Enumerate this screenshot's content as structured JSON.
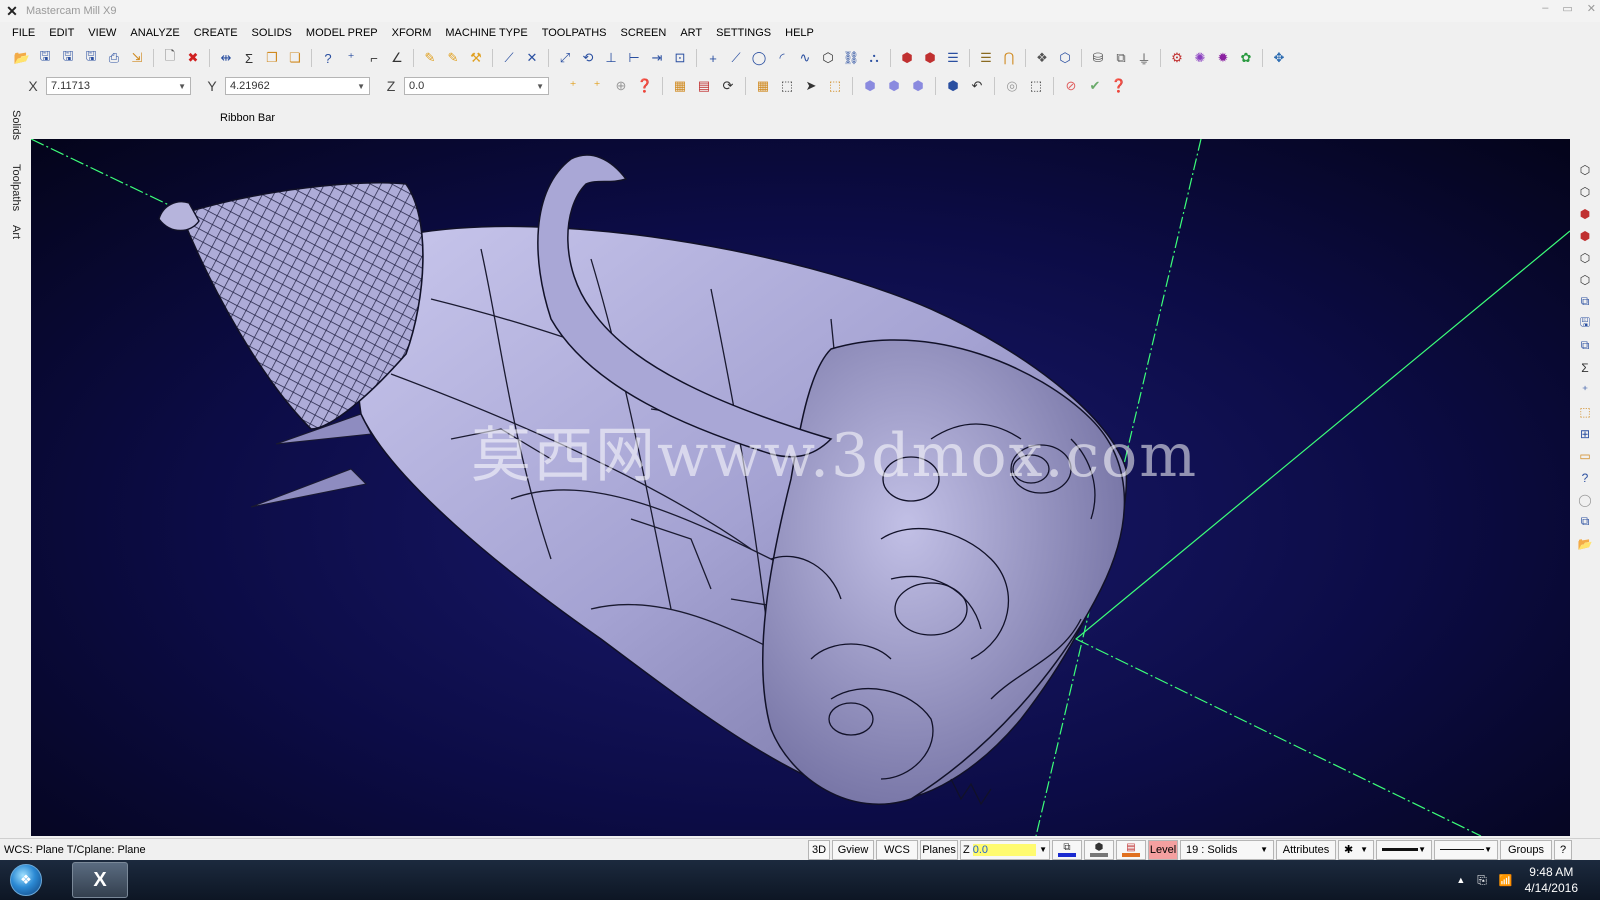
{
  "window": {
    "title": "Mastercam Mill X9",
    "controls": [
      "–",
      "▭",
      "✕"
    ]
  },
  "menu": [
    "FILE",
    "EDIT",
    "VIEW",
    "ANALYZE",
    "CREATE",
    "SOLIDS",
    "MODEL PREP",
    "XFORM",
    "MACHINE TYPE",
    "TOOLPATHS",
    "SCREEN",
    "ART",
    "SETTINGS",
    "HELP"
  ],
  "toolbar": {
    "icons": [
      "open-icon",
      "save-icon",
      "save-as-icon",
      "save-some-icon",
      "print-icon",
      "merge-icon",
      "new-icon",
      "close-file-icon",
      "move-icon",
      "sum-icon",
      "copy-icon",
      "paste-icon",
      "analyze-entity-icon",
      "analyze-point-icon",
      "dimension-icon",
      "angle-icon",
      "pencil-icon",
      "tools-icon",
      "wand-icon",
      "trim-icon",
      "break-icon",
      "join-icon",
      "offset-icon",
      "extend-icon",
      "modify-icon",
      "stretch-icon",
      "point-icon",
      "line-icon",
      "circle-icon",
      "arc-icon",
      "spline-icon",
      "box-icon",
      "chain-icon",
      "link-icon",
      "solid-extrude-icon",
      "solid-revolve-icon",
      "solid-layers-icon",
      "list-icon",
      "arch-icon",
      "probe-icon",
      "cube-icon",
      "surface-icon",
      "drive-icon",
      "machine-icon",
      "verify-icon",
      "gear-icon",
      "flower-icon",
      "lathe-icon"
    ]
  },
  "coords": {
    "x_label": "X",
    "x_value": "7.11713",
    "y_label": "Y",
    "y_value": "4.21962",
    "z_label": "Z",
    "z_value": "0.0"
  },
  "ribbon_label": "Ribbon Bar",
  "left_tabs": [
    "Solids",
    "Toolpaths",
    "Art"
  ],
  "watermark": "莫西网www.3dmox.com",
  "status": {
    "left": "WCS: Plane  T/Cplane: Plane",
    "buttons": [
      "3D",
      "Gview",
      "WCS",
      "Planes"
    ],
    "z_label": "Z",
    "z_value": "0.0",
    "level_label": "Level",
    "level_value": "19 : Solids",
    "attributes": "Attributes",
    "groups": "Groups",
    "help": "?"
  },
  "taskbar": {
    "time": "9:48 AM",
    "date": "4/14/2016"
  },
  "colors": {
    "viewport_bg": "#0c0c46",
    "model_fill": "#a9a7d6",
    "axis_green": "#3cff7a",
    "axis_blue": "#4a7bff",
    "z_highlight": "#fffb70"
  }
}
